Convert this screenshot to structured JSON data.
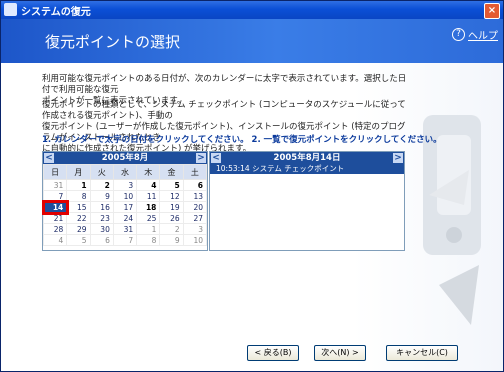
{
  "window": {
    "title": "システムの復元",
    "close_label": "×"
  },
  "banner": {
    "heading": "復元ポイントの選択",
    "help_label": "ヘルプ",
    "help_icon": "?"
  },
  "intro": {
    "para1_line1": "利用可能な復元ポイントのある日付が、次のカレンダーに太字で表示されています。選択した日付で利用可能な復元",
    "para1_line2": "ポイントが一覧に表示されています。",
    "para2_line1": "復元ポイントの種類として、システム チェックポイント (コンピュータのスケジュールに従って作成される復元ポイント)、手動の",
    "para2_line2": "復元ポイント (ユーザーが作成した復元ポイント)、インストールの復元ポイント (特定のプログラムがインストールされたとき",
    "para2_line3": "に自動的に作成された復元ポイント) が挙げられます。"
  },
  "instructions": "1. カレンダーで太字の日付をクリックしてください。 2. 一覧で復元ポイントをクリックしてください。",
  "calendar": {
    "prev": "<",
    "next": ">",
    "month_label": "2005年8月",
    "weekdays": [
      "日",
      "月",
      "火",
      "水",
      "木",
      "金",
      "土"
    ],
    "weeks": [
      [
        "31",
        "1",
        "2",
        "3",
        "4",
        "5",
        "6"
      ],
      [
        "7",
        "8",
        "9",
        "10",
        "11",
        "12",
        "13"
      ],
      [
        "14",
        "15",
        "16",
        "17",
        "18",
        "19",
        "20"
      ],
      [
        "21",
        "22",
        "23",
        "24",
        "25",
        "26",
        "27"
      ],
      [
        "28",
        "29",
        "30",
        "31",
        "1",
        "2",
        "3"
      ],
      [
        "4",
        "5",
        "6",
        "7",
        "8",
        "9",
        "10"
      ]
    ],
    "selected_day": "14"
  },
  "restore_list": {
    "prev": "<",
    "next": ">",
    "date_label": "2005年8月14日",
    "items": [
      "10:53:14 システム チェックポイント"
    ]
  },
  "buttons": {
    "back": "< 戻る(B)",
    "next": "次へ(N) >",
    "cancel": "キャンセル(C)"
  },
  "colors": {
    "accent": "#1e4e9c",
    "highlight": "#e00000"
  }
}
